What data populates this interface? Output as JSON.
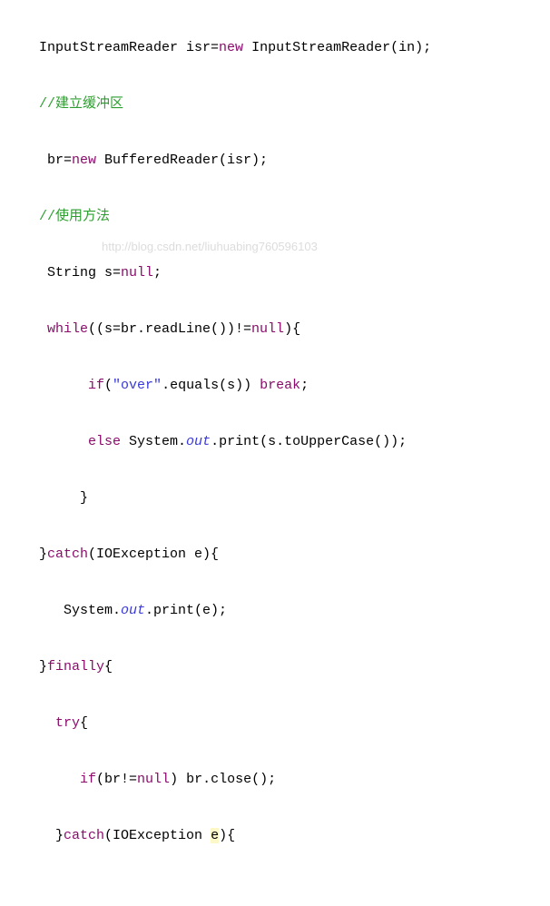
{
  "code": {
    "l1": {
      "t1": " InputStreamReader isr=",
      "new": "new",
      "t2": " InputStreamReader(in);"
    },
    "l2": " //建立缓冲区",
    "l3": {
      "t1": "  br=",
      "new": "new",
      "t2": " BufferedReader(isr);"
    },
    "l4": " //使用方法",
    "l5": {
      "t1": "  String s=",
      "null": "null",
      "t2": ";"
    },
    "l6": {
      "while": "  while",
      "t1": "((s=br.readLine())!=",
      "null": "null",
      "t2": "){"
    },
    "l7": {
      "t1": "       ",
      "if": "if",
      "t2": "(",
      "str": "\"over\"",
      "t3": ".equals(s)) ",
      "break": "break",
      "t4": ";"
    },
    "l8": {
      "t1": "       ",
      "else": "else",
      "t2": " System.",
      "out": "out",
      "t3": ".print(s.toUpperCase());"
    },
    "l9": "      }",
    "l10": {
      "t1": " }",
      "catch": "catch",
      "t2": "(IOException e){"
    },
    "l11": {
      "t1": "    System.",
      "out": "out",
      "t2": ".print(e);"
    },
    "l12": {
      "t1": " }",
      "finally": "finally",
      "t2": "{"
    },
    "l13": {
      "t1": "   ",
      "try": "try",
      "t2": "{"
    },
    "l14": {
      "t1": "      ",
      "if": "if",
      "t2": "(br!=",
      "null": "null",
      "t3": ") br.close();"
    },
    "l15": {
      "t1": "   }",
      "catch": "catch",
      "t2": "(IOException ",
      "e": "e",
      "t3": "){"
    }
  },
  "watermark": "http://blog.csdn.net/liuhuabing760596103"
}
